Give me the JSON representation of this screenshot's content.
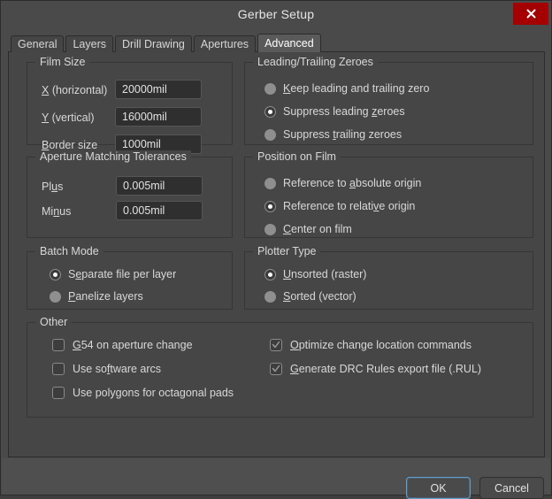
{
  "window": {
    "title": "Gerber Setup",
    "close_icon": "close-icon",
    "close_color": "#a50000"
  },
  "tabs": [
    {
      "label": "General",
      "active": false
    },
    {
      "label": "Layers",
      "active": false
    },
    {
      "label": "Drill Drawing",
      "active": false
    },
    {
      "label": "Apertures",
      "active": false
    },
    {
      "label": "Advanced",
      "active": true
    }
  ],
  "film_size": {
    "legend": "Film Size",
    "fields": [
      {
        "label_pre": "",
        "label_mnemonic": "X",
        "label_post": " (horizontal)",
        "value": "20000mil"
      },
      {
        "label_pre": "",
        "label_mnemonic": "Y",
        "label_post": " (vertical)",
        "value": "16000mil"
      },
      {
        "label_pre": "",
        "label_mnemonic": "B",
        "label_post": "order size",
        "value": "1000mil"
      }
    ]
  },
  "zeroes": {
    "legend": "Leading/Trailing Zeroes",
    "options": [
      {
        "pre": "",
        "mnemonic": "K",
        "post": "eep leading and trailing zero",
        "selected": false
      },
      {
        "pre": "Suppress leading ",
        "mnemonic": "z",
        "post": "eroes",
        "selected": true
      },
      {
        "pre": "Suppress ",
        "mnemonic": "t",
        "post": "railing zeroes",
        "selected": false
      }
    ]
  },
  "tolerances": {
    "legend": "Aperture Matching Tolerances",
    "fields": [
      {
        "pre": "Pl",
        "mnemonic": "u",
        "post": "s",
        "value": "0.005mil"
      },
      {
        "pre": "Mi",
        "mnemonic": "n",
        "post": "us",
        "value": "0.005mil"
      }
    ]
  },
  "position": {
    "legend": "Position on Film",
    "options": [
      {
        "pre": "Reference to ",
        "mnemonic": "a",
        "post": "bsolute origin",
        "selected": false
      },
      {
        "pre": "Reference to relati",
        "mnemonic": "v",
        "post": "e origin",
        "selected": true
      },
      {
        "pre": "",
        "mnemonic": "C",
        "post": "enter on film",
        "selected": false
      }
    ]
  },
  "batch_mode": {
    "legend": "Batch Mode",
    "options": [
      {
        "pre": "S",
        "mnemonic": "e",
        "post": "parate file per layer",
        "selected": true,
        "clipped": true
      },
      {
        "pre": "",
        "mnemonic": "P",
        "post": "anelize layers",
        "selected": false,
        "clipped": false
      }
    ]
  },
  "plotter_type": {
    "legend": "Plotter Type",
    "options": [
      {
        "pre": "",
        "mnemonic": "U",
        "post": "nsorted (raster)",
        "selected": true
      },
      {
        "pre": "",
        "mnemonic": "S",
        "post": "orted (vector)",
        "selected": false
      }
    ]
  },
  "other": {
    "legend": "Other",
    "left_column": [
      {
        "pre": "",
        "mnemonic": "G",
        "post": "54 on aperture change",
        "checked": false
      },
      {
        "pre": "Use so",
        "mnemonic": "f",
        "post": "tware arcs",
        "checked": false
      },
      {
        "pre": "Use polygons for octagonal pads",
        "mnemonic": "",
        "post": "",
        "checked": false
      }
    ],
    "right_column": [
      {
        "pre": "",
        "mnemonic": "O",
        "post": "ptimize change location commands",
        "checked": true
      },
      {
        "pre": "",
        "mnemonic": "G",
        "post": "enerate DRC Rules export file (.RUL)",
        "checked": true
      }
    ]
  },
  "footer": {
    "ok_label": "OK",
    "cancel_label": "Cancel",
    "default_accent": "#5f9fd0"
  }
}
